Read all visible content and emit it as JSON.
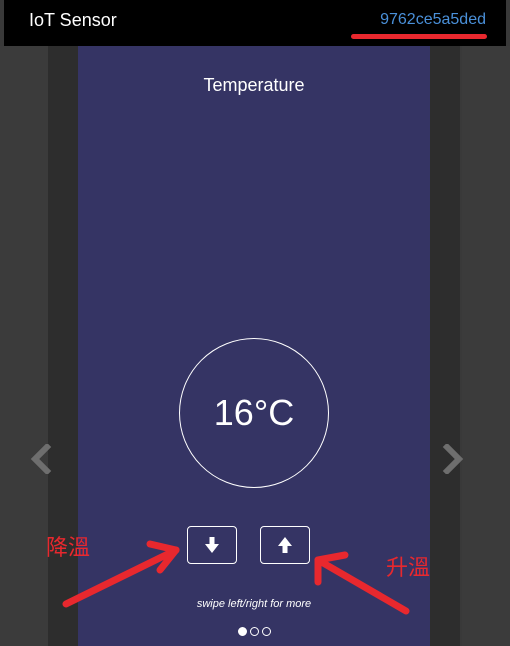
{
  "header": {
    "app_title": "IoT Sensor",
    "device_id": "9762ce5a5ded"
  },
  "slide": {
    "title": "Temperature",
    "value": "16°C",
    "hint": "swipe left/right for more",
    "buttons": {
      "decrease_icon": "arrow-down-icon",
      "increase_icon": "arrow-up-icon"
    }
  },
  "pagination": {
    "current_page": 1,
    "total_pages": 3
  },
  "annotations": {
    "decrease_label": "降溫",
    "increase_label": "升溫",
    "color": "#e8282e"
  },
  "colors": {
    "slide_bg": "#353464",
    "topbar_bg": "#000000",
    "device_id": "#4a90d9"
  }
}
